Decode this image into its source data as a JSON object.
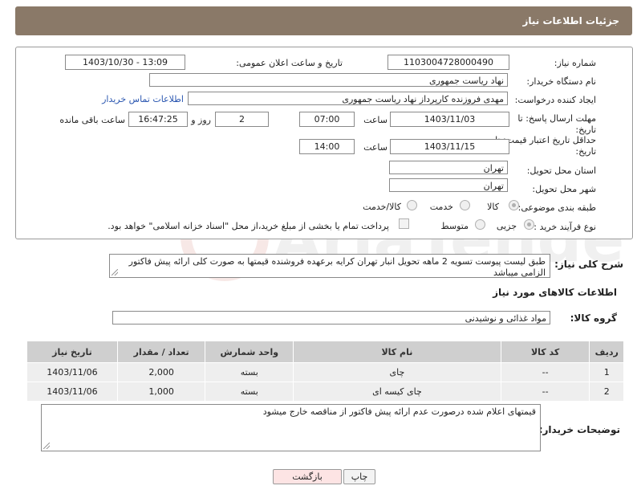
{
  "header": {
    "title": "جزئیات اطلاعات نیاز"
  },
  "form": {
    "need_number_label": "شماره نیاز:",
    "need_number": "1103004728000490",
    "announce_label": "تاریخ و ساعت اعلان عمومی:",
    "announce_value": "1403/10/30 - 13:09",
    "buyer_org_label": "نام دستگاه خریدار:",
    "buyer_org": "نهاد ریاست جمهوری",
    "creator_label": "ایجاد کننده درخواست:",
    "creator": "مهدی فروزنده کارپرداز نهاد ریاست جمهوری",
    "contact_link": "اطلاعات تماس خریدار",
    "deadline_label": "مهلت ارسال پاسخ: تا تاریخ:",
    "deadline_date": "1403/11/03",
    "time_label": "ساعت",
    "deadline_time": "07:00",
    "days_value": "2",
    "days_label": "روز و",
    "remaining_time": "16:47:25",
    "remaining_label": "ساعت باقی مانده",
    "validity_label": "حداقل تاریخ اعتبار قیمت: تا تاریخ:",
    "validity_date": "1403/11/15",
    "validity_time_label": "ساعت",
    "validity_time": "14:00",
    "province_label": "استان محل تحویل:",
    "province": "تهران",
    "city_label": "شهر محل تحویل:",
    "city": "تهران",
    "category_label": "طبقه بندی موضوعی:",
    "category_options": [
      "کالا",
      "خدمت",
      "کالا/خدمت"
    ],
    "purchase_type_label": "نوع فرآیند خرید :",
    "purchase_options": [
      "جزیی",
      "متوسط"
    ],
    "payment_note": "پرداخت تمام یا بخشی از مبلغ خرید،از محل \"اسناد خزانه اسلامی\" خواهد بود."
  },
  "description": {
    "label": "شرح کلی نیاز:",
    "text": "طبق لیست پیوست تسویه 2 ماهه تحویل انبار تهران کرایه برعهده فروشنده قیمتها به صورت کلی ارائه پیش فاکتور الزامی میباشد"
  },
  "goods": {
    "section_title": "اطلاعات کالاهای مورد نیاز",
    "group_label": "گروه کالا:",
    "group_value": "مواد غذائی و نوشیدنی",
    "columns": [
      "ردیف",
      "کد کالا",
      "نام کالا",
      "واحد شمارش",
      "تعداد / مقدار",
      "تاریخ نیاز"
    ],
    "rows": [
      {
        "row": "1",
        "code": "--",
        "name": "چای",
        "unit": "بسته",
        "qty": "2,000",
        "date": "1403/11/06"
      },
      {
        "row": "2",
        "code": "--",
        "name": "چای کیسه ای",
        "unit": "بسته",
        "qty": "1,000",
        "date": "1403/11/06"
      }
    ]
  },
  "buyer_notes": {
    "label": "توضیحات خریدار:",
    "text": "قیمتهای اعلام شده درصورت عدم ارائه پیش فاکتور از مناقصه خارج میشود"
  },
  "buttons": {
    "print": "چاپ",
    "back": "بازگشت"
  },
  "colors": {
    "header_bg": "#8a7968",
    "link": "#2a56b0",
    "back_bg": "#fde4e4"
  }
}
